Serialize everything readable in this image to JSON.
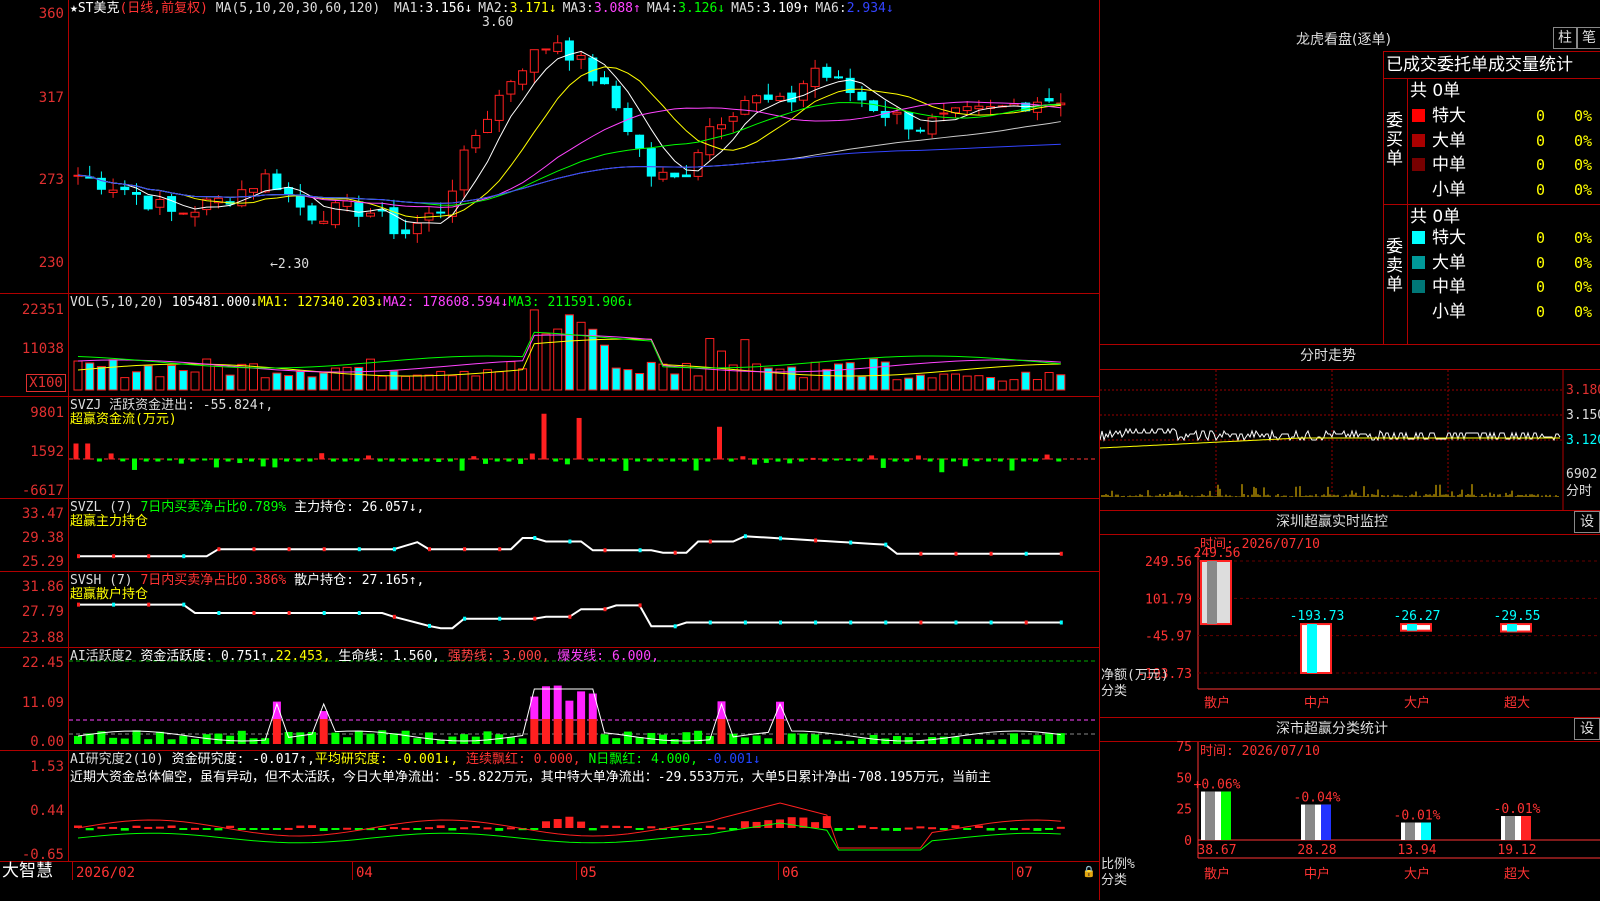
{
  "stock": {
    "name": "★ST美克",
    "period": "(日线,前复权)",
    "ma_label": "MA(5,10,20,30,60,120)",
    "ma": [
      {
        "k": "MA1:",
        "v": "3.156↓",
        "c": "#ffffff"
      },
      {
        "k": "MA2:",
        "v": "3.171↓",
        "c": "#ffff00"
      },
      {
        "k": "MA3:",
        "v": "3.088↑",
        "c": "#ff44ff"
      },
      {
        "k": "MA4:",
        "v": "3.126↓",
        "c": "#00ff00"
      },
      {
        "k": "MA5:",
        "v": "3.109↑",
        "c": "#ffffff"
      },
      {
        "k": "MA6:",
        "v": "2.934↓",
        "c": "#3344ff"
      }
    ],
    "high_mark": "3.60",
    "low_mark": "←2.30"
  },
  "price_axis": [
    "360",
    "317",
    "273",
    "230"
  ],
  "vol": {
    "label": "VOL(5,10,20)",
    "value": "105481.000↓",
    "ma1": "MA1: 127340.203↓",
    "ma2": "MA2: 178608.594↓",
    "ma3": "MA3: 211591.906↓",
    "axis": [
      "22351",
      "11038",
      "X100"
    ]
  },
  "svzj": {
    "label": "SVZJ",
    "desc": "活跃资金进出: -55.824↑,",
    "sub": "超赢资金流(万元)",
    "axis": [
      "9801",
      "1592",
      "-6617"
    ]
  },
  "svzl": {
    "label": "SVZL (7)",
    "desc": "7日内买卖净占比0.789%",
    "hold": "主力持仓: 26.057↓,",
    "sub": "超赢主力持仓",
    "axis": [
      "33.47",
      "29.38",
      "25.29"
    ]
  },
  "svsh": {
    "label": "SVSH (7)",
    "desc": "7日内买卖净占比0.386%",
    "hold": "散户持仓: 27.165↑,",
    "sub": "超赢散户持仓",
    "axis": [
      "31.86",
      "27.79",
      "23.88"
    ]
  },
  "ai1": {
    "label": "AI活跃度2",
    "a": "资金活跃度: 0.751↑,",
    "b": "22.453,",
    "c": "生命线: 1.560,",
    "d": "强势线: 3.000,",
    "e": "爆发线: 6.000,",
    "axis": [
      "22.45",
      "11.09",
      "0.00"
    ]
  },
  "ai2": {
    "label": "AI研究度2(10)",
    "a": "资金研究度: -0.017↑,",
    "b": "平均研究度: -0.001↓,",
    "c": "连续飘红: 0.000,",
    "d": "N日飘红: 4.000,",
    "e": "-0.001↓",
    "text": "近期大资金总体偏空，虽有异动，但不太活跃，今日大单净流出：-55.822万元，其中特大单净流出：-29.553万元，大单5日累计净出-708.195万元，当前主",
    "axis": [
      "1.53",
      "0.44",
      "-0.65"
    ]
  },
  "bottom": {
    "brand": "大智慧",
    "dates": [
      "2026/02",
      "04",
      "05",
      "06",
      "07"
    ]
  },
  "lhb": {
    "title": "龙虎看盘(逐单)",
    "btn1": "柱",
    "btn2": "笔",
    "tabs": "已成交委托单成交量统计",
    "buy_title": "委买单",
    "buy_total": "共 0单",
    "sell_title": "委卖单",
    "sell_total": "共 0单",
    "buy": [
      {
        "n": "特大",
        "c": "#ff0000"
      },
      {
        "n": "大单",
        "c": "#aa0000"
      },
      {
        "n": "中单",
        "c": "#770000"
      },
      {
        "n": "小单",
        "c": "#000000"
      }
    ],
    "sell": [
      {
        "n": "特大",
        "c": "#00ffff"
      },
      {
        "n": "大单",
        "c": "#009999"
      },
      {
        "n": "中单",
        "c": "#007777"
      },
      {
        "n": "小单",
        "c": "#000000"
      }
    ],
    "zero": "0",
    "pct": "0%"
  },
  "fenshi": {
    "title": "分时走势",
    "axis": [
      "3.180",
      "3.150",
      "3.120",
      "6902",
      "分时"
    ]
  },
  "szmon": {
    "title": "深圳超赢实时监控",
    "btn": "设",
    "time": "时间: 2026/07/10",
    "axis": [
      "249.56",
      "101.79",
      "-45.97",
      "-193.73"
    ],
    "ylab": "净额(万元)",
    "xlab": "分类",
    "bars": [
      {
        "name": "散户",
        "v": 249.56,
        "label": "249.56"
      },
      {
        "name": "中户",
        "v": -193.73,
        "label": "-193.73"
      },
      {
        "name": "大户",
        "v": -26.27,
        "label": "-26.27"
      },
      {
        "name": "超大",
        "v": -29.55,
        "label": "-29.55"
      }
    ]
  },
  "szcls": {
    "title": "深市超赢分类统计",
    "btn": "设",
    "time": "时间: 2026/07/10",
    "axis": [
      "75",
      "50",
      "25",
      "0"
    ],
    "ylab": "比例%",
    "xlab": "分类",
    "bars": [
      {
        "name": "散户",
        "v": 38.67,
        "top": "+0.06%",
        "bottom": "38.67",
        "c": "#00ff00"
      },
      {
        "name": "中户",
        "v": 28.28,
        "top": "-0.04%",
        "bottom": "28.28",
        "c": "#2233ff"
      },
      {
        "name": "大户",
        "v": 13.94,
        "top": "-0.01%",
        "bottom": "13.94",
        "c": "#00ffff"
      },
      {
        "name": "超大",
        "v": 19.12,
        "top": "-0.01%",
        "bottom": "19.12",
        "c": "#ff2222"
      }
    ]
  }
}
